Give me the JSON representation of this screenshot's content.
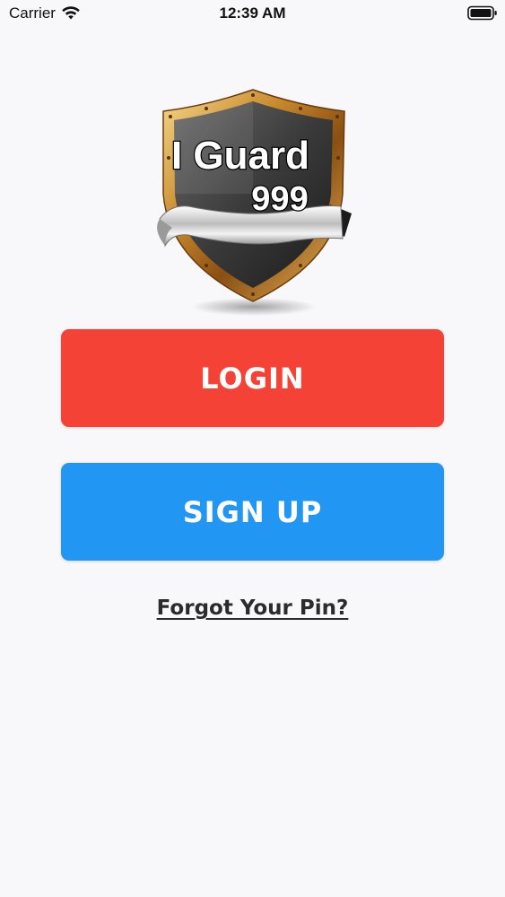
{
  "status_bar": {
    "carrier": "Carrier",
    "time": "12:39 AM"
  },
  "logo": {
    "line1": "I Guard",
    "line2": "999"
  },
  "actions": {
    "login_label": "LOGIN",
    "signup_label": "SIGN UP",
    "forgot_label": "Forgot Your Pin?"
  },
  "colors": {
    "login": "#f44336",
    "signup": "#2196f3",
    "background": "#f8f8fa"
  },
  "icons": [
    "wifi-icon",
    "battery-icon",
    "shield-logo"
  ]
}
